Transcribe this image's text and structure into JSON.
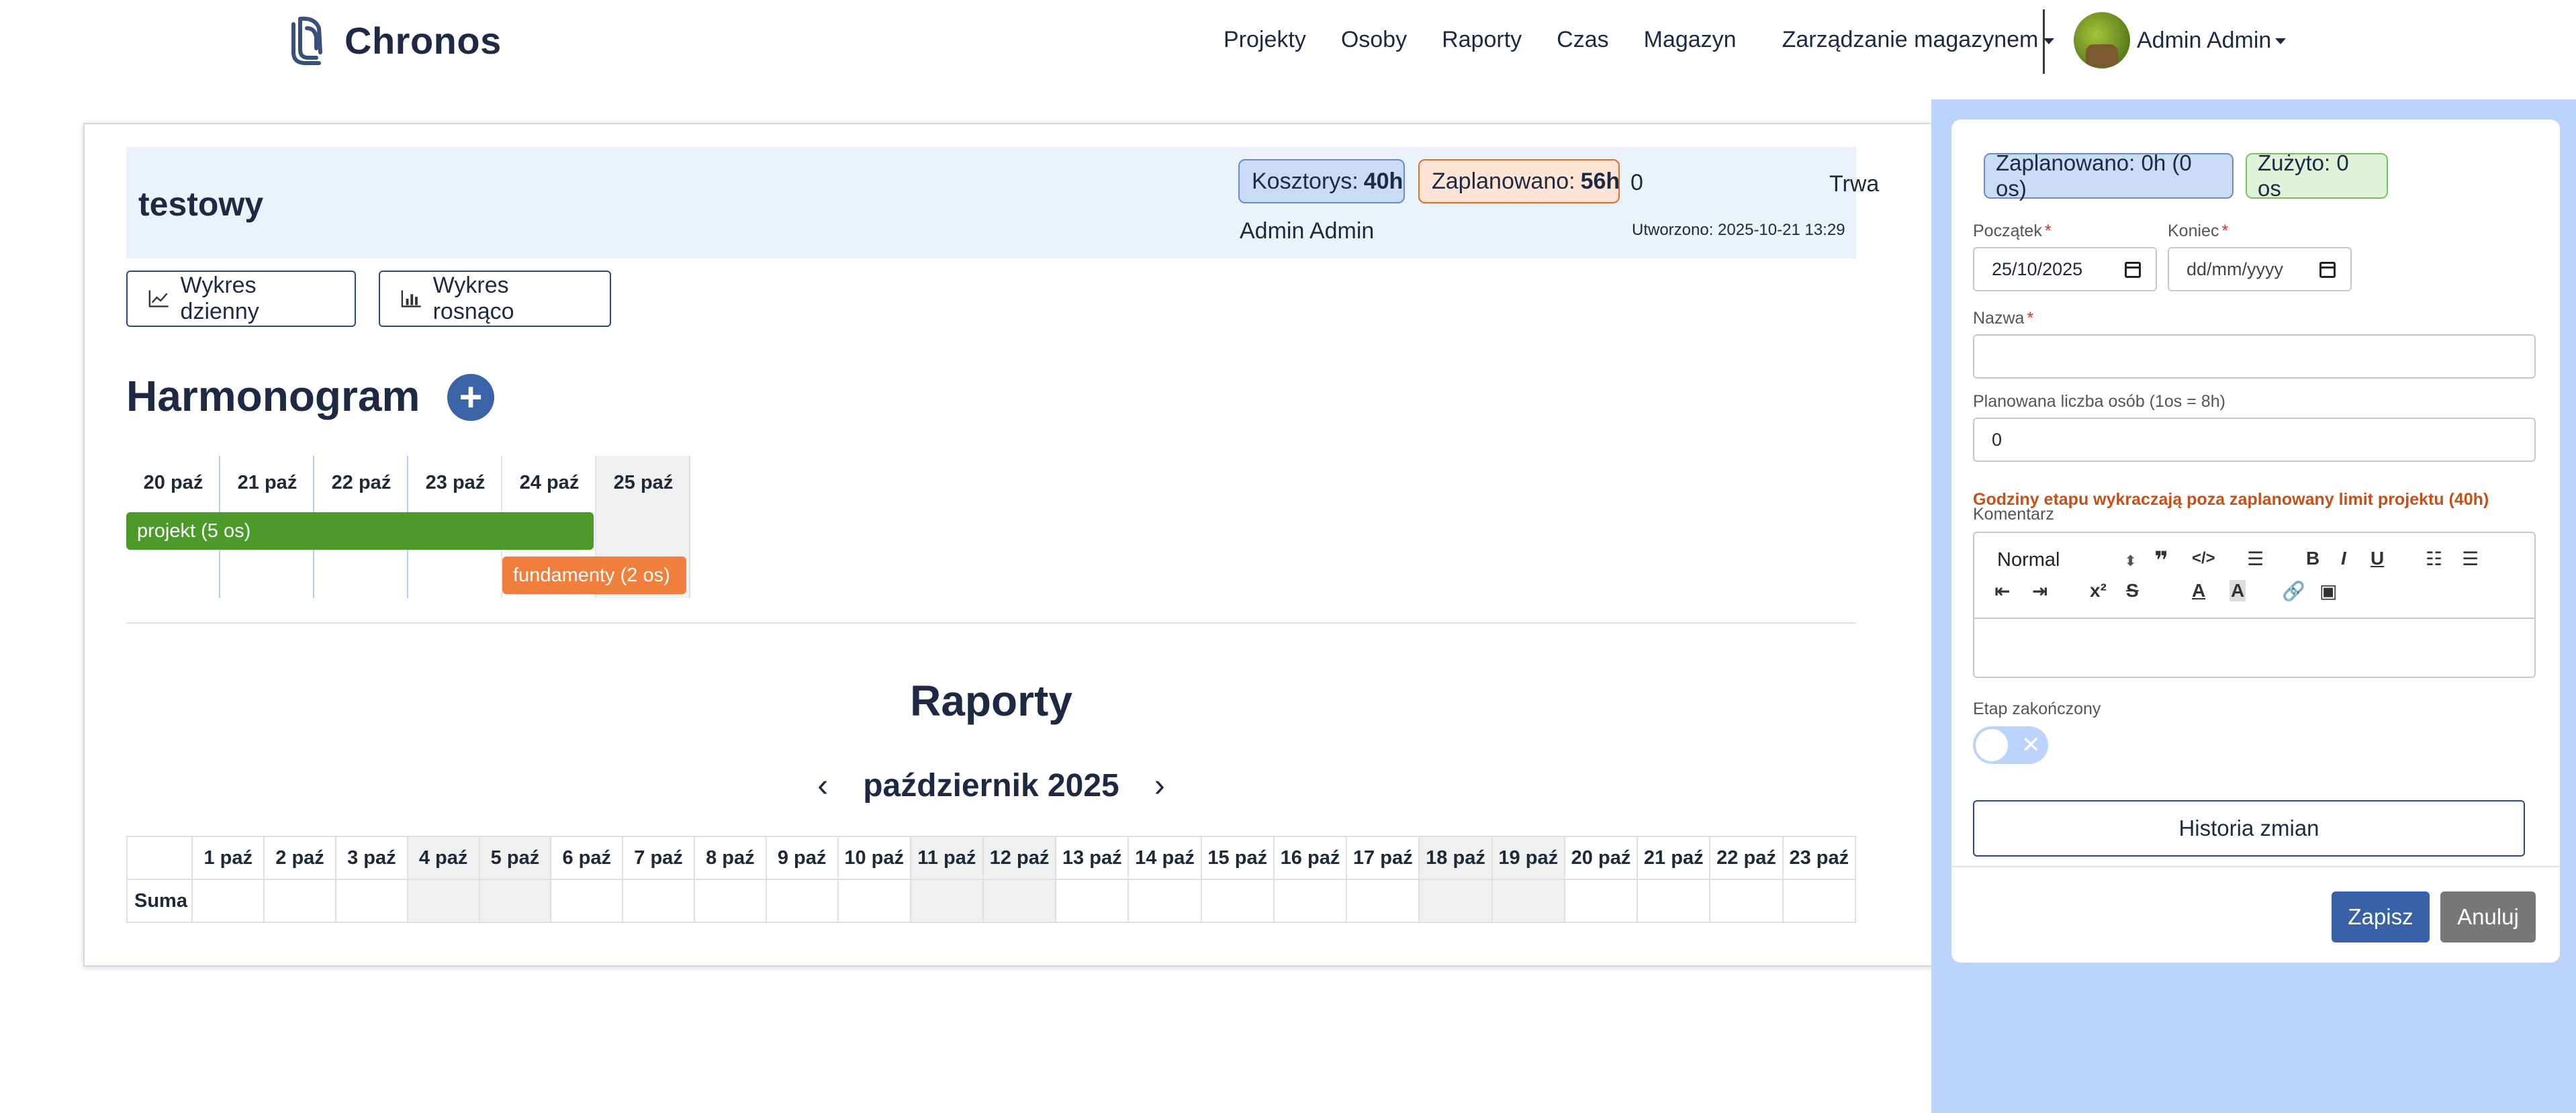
{
  "nav": {
    "brand": "Chronos",
    "links": [
      "Projekty",
      "Osoby",
      "Raporty",
      "Czas",
      "Magazyn"
    ],
    "warehouse_mgmt": "Zarządzanie magazynem",
    "user_name": "Admin Admin"
  },
  "project": {
    "title": "testowy",
    "estimate_label": "Kosztorys:",
    "estimate_value": "40h",
    "planned_label": "Zaplanowano:",
    "planned_value": "56h",
    "extra_value": "0",
    "status": "Trwa",
    "owner": "Admin Admin",
    "created": "Utworzono: 2025-10-21 13:29"
  },
  "buttons": {
    "daily_chart": "Wykres dzienny",
    "rising_chart": "Wykres rosnąco"
  },
  "schedule": {
    "title": "Harmonogram",
    "add_label": "+",
    "days": [
      "20 paź",
      "21 paź",
      "22 paź",
      "23 paź",
      "24 paź",
      "25 paź"
    ],
    "bars": [
      {
        "label": "projekt (5 os)",
        "color": "#4c9a2a"
      },
      {
        "label": "fundamenty (2 os)",
        "color": "#f07e3c"
      }
    ]
  },
  "reports": {
    "title": "Raporty",
    "month": "październik 2025",
    "prev": "‹",
    "next": "›",
    "sum_label": "Suma",
    "days": [
      "1 paź",
      "2 paź",
      "3 paź",
      "4 paź",
      "5 paź",
      "6 paź",
      "7 paź",
      "8 paź",
      "9 paź",
      "10 paź",
      "11 paź",
      "12 paź",
      "13 paź",
      "14 paź",
      "15 paź",
      "16 paź",
      "17 paź",
      "18 paź",
      "19 paź",
      "20 paź",
      "21 paź",
      "22 paź",
      "23 paź"
    ]
  },
  "side": {
    "planned_badge": "Zaplanowano: 0h (0 os)",
    "used_badge": "Zużyto: 0 os",
    "start_label": "Początek",
    "end_label": "Koniec",
    "start_value": "25/10/2025",
    "end_placeholder": "dd/mm/yyyy",
    "name_label": "Nazwa",
    "people_label": "Planowana liczba osób (1os = 8h)",
    "people_value": "0",
    "warning": "Godziny etapu wykraczają poza zaplanowany limit projektu (40h)",
    "comment_label": "Komentarz",
    "format_select": "Normal",
    "finished_label": "Etap zakończony",
    "history_button": "Historia zmian",
    "save_button": "Zapisz",
    "cancel_button": "Anuluj"
  },
  "colors": {
    "accent": "#3961a8",
    "panel_bg": "#bcd3fb",
    "green": "#4c9a2a",
    "orange": "#f07e3c",
    "warning": "#c4501a"
  }
}
